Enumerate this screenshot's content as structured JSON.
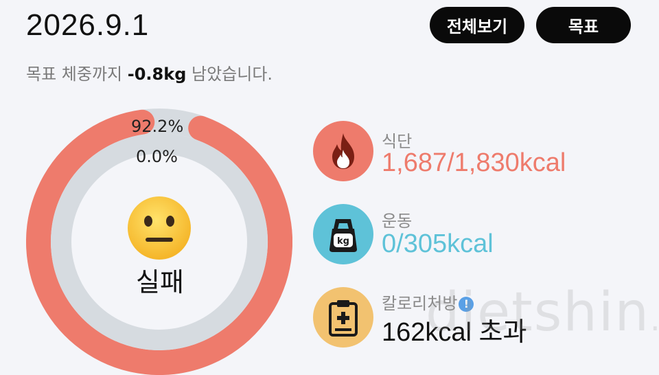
{
  "header": {
    "date": "2026.9.1",
    "view_all_label": "전체보기",
    "goal_label": "목표"
  },
  "subtitle": {
    "prefix": "목표 체중까지 ",
    "value": "-0.8kg",
    "suffix": " 남았습니다."
  },
  "ring": {
    "outer_percent_label": "92.2%",
    "inner_percent_label": "0.0%",
    "outer_progress": 0.922,
    "inner_progress": 0.0,
    "status_icon": "neutral-face-icon",
    "status_label": "실패",
    "colors": {
      "outer": "#ee7b6c",
      "track": "#d6dbe0"
    }
  },
  "stats": {
    "diet": {
      "label": "식단",
      "value": "1,687/1,830kcal",
      "icon": "fire-icon",
      "color": "#ee7b6c"
    },
    "exercise": {
      "label": "운동",
      "value": "0/305kcal",
      "icon": "kettlebell-icon",
      "color": "#5ec2d8"
    },
    "prescription": {
      "label": "칼로리처방",
      "value": "162kcal 초과",
      "icon": "clipboard-icon",
      "color": "#f2c270",
      "info_icon": "info-icon"
    }
  },
  "watermark": {
    "text": "dietshin",
    "suffix": ".com"
  }
}
